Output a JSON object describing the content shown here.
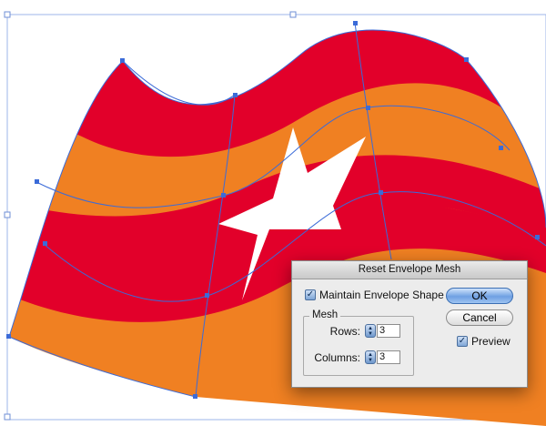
{
  "colors": {
    "red": "#e2002a",
    "orange": "#f08022",
    "mesh_line": "#3b6bd8",
    "star": "#ffffff"
  },
  "dialog": {
    "title": "Reset Envelope Mesh",
    "maintain_label": "Maintain Envelope Shape",
    "maintain_checked": true,
    "mesh_group_label": "Mesh",
    "rows_label": "Rows:",
    "rows_value": "3",
    "columns_label": "Columns:",
    "columns_value": "3",
    "ok_label": "OK",
    "cancel_label": "Cancel",
    "preview_label": "Preview",
    "preview_checked": true
  },
  "icons": {
    "checkmark": "✓",
    "stepper_up": "▲",
    "stepper_down": "▼"
  }
}
